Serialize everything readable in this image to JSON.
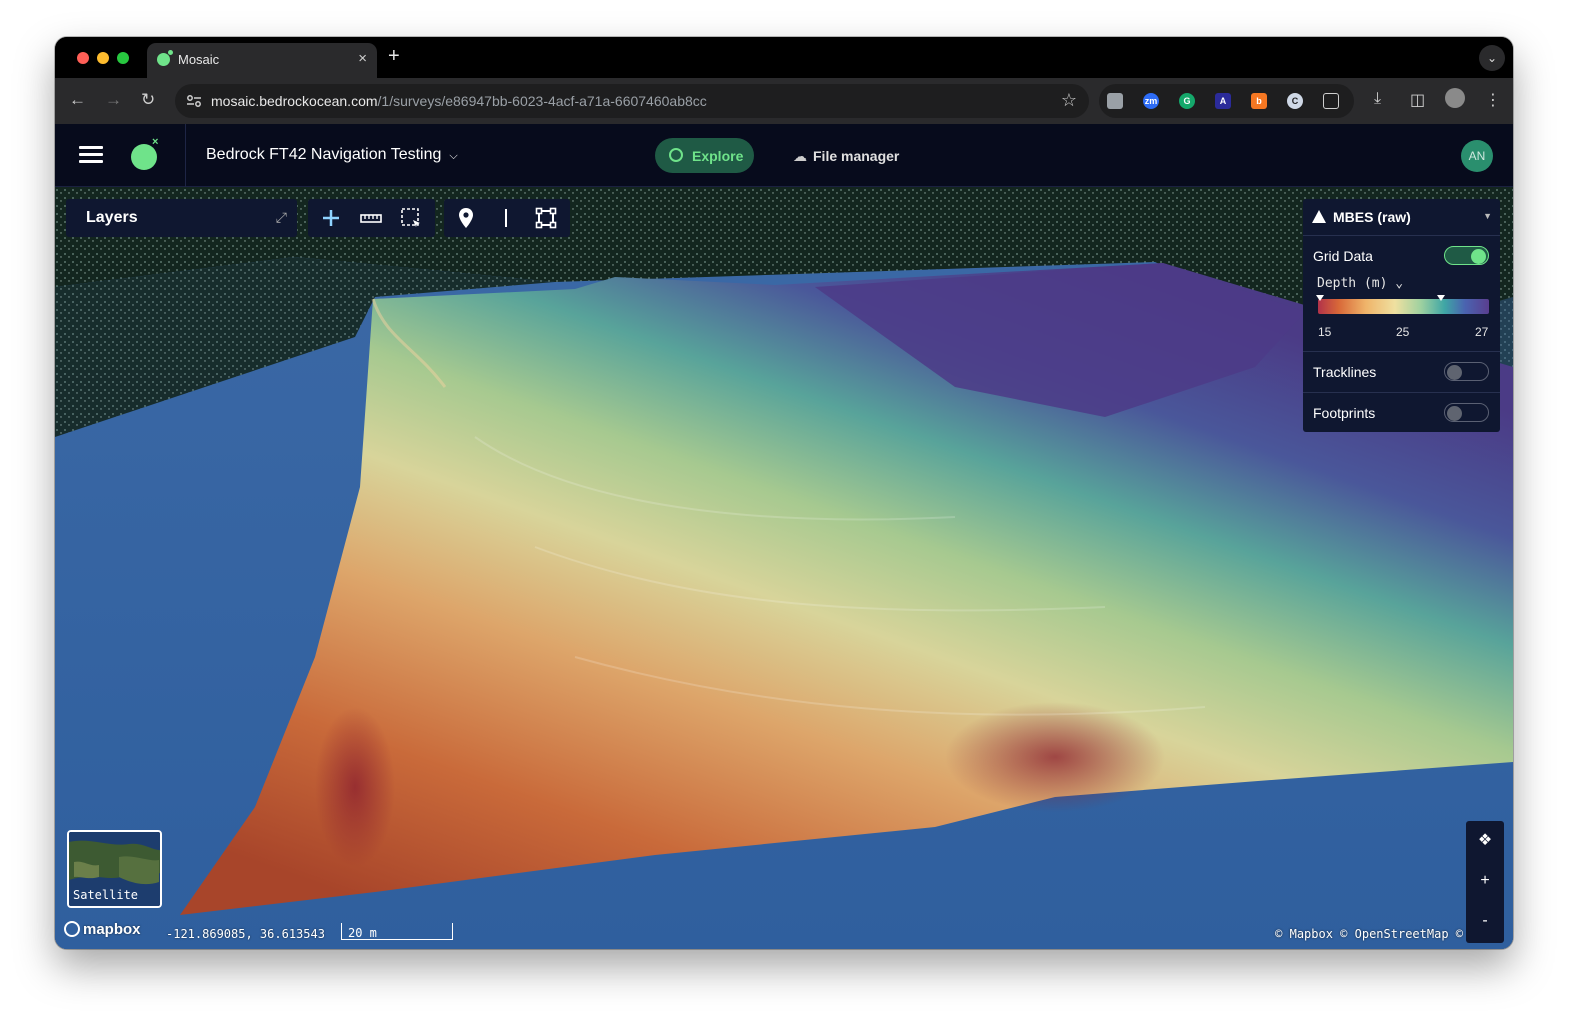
{
  "browser": {
    "tab_title": "Mosaic",
    "tab_close": "×",
    "new_tab": "+",
    "url_host": "mosaic.bedrockocean.com",
    "url_path": "/1/surveys/e86947bb-6023-4acf-a71a-6607460ab8cc"
  },
  "app": {
    "project_name": "Bedrock FT42 Navigation Testing",
    "nav": {
      "explore_label": "Explore",
      "file_manager_label": "File manager"
    },
    "user_initials": "AN"
  },
  "map": {
    "layers_title": "Layers",
    "layer_panel": {
      "title": "MBES (raw)",
      "grid_data_label": "Grid Data",
      "grid_data_on": true,
      "color_by": "Depth (m)",
      "ramp_ticks": [
        "15",
        "25",
        "27"
      ],
      "tracklines_label": "Tracklines",
      "tracklines_on": false,
      "footprints_label": "Footprints",
      "footprints_on": false
    },
    "basemap_label": "Satellite",
    "brand": "mapbox",
    "coordinates": "-121.869085, 36.613543",
    "scale_label": "20 m",
    "attribution": "© Mapbox © OpenStreetMap ©",
    "zoom_in": "+",
    "zoom_out": "-"
  },
  "colors": {
    "accent": "#6fe38a",
    "panel_bg": "#0f1730",
    "header_bg": "#070b1c"
  }
}
